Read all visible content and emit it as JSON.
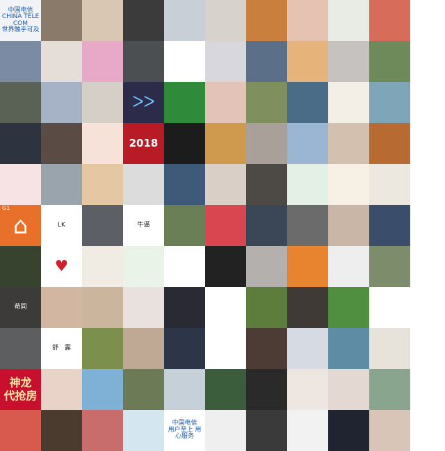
{
  "tiles": [
    {
      "bg": "#f1f3f7",
      "fg": "#1e5aa8",
      "caption": "中国电信\nCHINA TELECOM\n世界触手可及",
      "icon": "",
      "style": "",
      "name": "tile-china-telecom-logo"
    },
    {
      "bg": "#8a7a6a",
      "fg": "",
      "caption": "",
      "icon": "",
      "style": "",
      "name": "tile-photo-portrait"
    },
    {
      "bg": "#d9c6b3",
      "fg": "",
      "caption": "",
      "icon": "",
      "style": "",
      "name": "tile-photo-children"
    },
    {
      "bg": "#3b3b3b",
      "fg": "",
      "caption": "",
      "icon": "",
      "style": "",
      "name": "tile-photo-couple"
    },
    {
      "bg": "#c9cfd6",
      "fg": "",
      "caption": "",
      "icon": "",
      "style": "",
      "name": "tile-photo-beach"
    },
    {
      "bg": "#d8d2cc",
      "fg": "",
      "caption": "",
      "icon": "",
      "style": "",
      "name": "tile-photo-woman"
    },
    {
      "bg": "#c97f3d",
      "fg": "",
      "caption": "",
      "icon": "",
      "style": "",
      "name": "tile-photo-cat"
    },
    {
      "bg": "#e6c2b3",
      "fg": "",
      "caption": "",
      "icon": "",
      "style": "",
      "name": "tile-photo-selfie"
    },
    {
      "bg": "#e9ece5",
      "fg": "",
      "caption": "",
      "icon": "",
      "style": "",
      "name": "tile-photo-cartoon"
    },
    {
      "bg": "#d86c5a",
      "fg": "",
      "caption": "",
      "icon": "",
      "style": "",
      "name": "tile-photo-toy"
    },
    {
      "bg": "#7a8ba3",
      "fg": "",
      "caption": "",
      "icon": "",
      "style": "",
      "name": "tile-photo-costume"
    },
    {
      "bg": "#e5ddd7",
      "fg": "",
      "caption": "",
      "icon": "",
      "style": "",
      "name": "tile-photo-portrait"
    },
    {
      "bg": "#e7a9c7",
      "fg": "",
      "caption": "",
      "icon": "",
      "style": "",
      "name": "tile-photo-pink-pig"
    },
    {
      "bg": "#4b4f52",
      "fg": "",
      "caption": "",
      "icon": "",
      "style": "",
      "name": "tile-photo-room"
    },
    {
      "bg": "#ffffff",
      "fg": "",
      "caption": "",
      "icon": "",
      "style": "",
      "name": "tile-blank"
    },
    {
      "bg": "#d7d7dd",
      "fg": "",
      "caption": "",
      "icon": "",
      "style": "",
      "name": "tile-photo-umbrella"
    },
    {
      "bg": "#5c6f88",
      "fg": "",
      "caption": "",
      "icon": "",
      "style": "",
      "name": "tile-photo-road"
    },
    {
      "bg": "#e6b47a",
      "fg": "",
      "caption": "",
      "icon": "",
      "style": "",
      "name": "tile-photo-doll"
    },
    {
      "bg": "#c5c2bf",
      "fg": "",
      "caption": "",
      "icon": "",
      "style": "",
      "name": "tile-photo-wedding"
    },
    {
      "bg": "#6e8a5a",
      "fg": "",
      "caption": "",
      "icon": "",
      "style": "",
      "name": "tile-photo-rain"
    },
    {
      "bg": "#5a6256",
      "fg": "",
      "caption": "",
      "icon": "",
      "style": "",
      "name": "tile-photo-window"
    },
    {
      "bg": "#a6b3c6",
      "fg": "",
      "caption": "",
      "icon": "",
      "style": "",
      "name": "tile-photo-kimono"
    },
    {
      "bg": "#d6cfc8",
      "fg": "",
      "caption": "",
      "icon": "",
      "style": "",
      "name": "tile-photo-flowers"
    },
    {
      "bg": "#2c2c4a",
      "fg": "#6ec6ff",
      "caption": "",
      "icon": "ᐳᐳ",
      "style": "",
      "name": "tile-logo-zigzag"
    },
    {
      "bg": "#2f8a3a",
      "fg": "",
      "caption": "",
      "icon": "",
      "style": "",
      "name": "tile-photo-panda"
    },
    {
      "bg": "#e3c3b8",
      "fg": "",
      "caption": "",
      "icon": "",
      "style": "",
      "name": "tile-photo-hand-toy"
    },
    {
      "bg": "#7f8f5e",
      "fg": "",
      "caption": "",
      "icon": "",
      "style": "",
      "name": "tile-photo-bunny-ears"
    },
    {
      "bg": "#4a6c86",
      "fg": "",
      "caption": "",
      "icon": "",
      "style": "",
      "name": "tile-photo-mountains"
    },
    {
      "bg": "#f4efe6",
      "fg": "",
      "caption": "",
      "icon": "",
      "style": "",
      "name": "tile-photo-anime-girl"
    },
    {
      "bg": "#7fa6b8",
      "fg": "",
      "caption": "",
      "icon": "",
      "style": "",
      "name": "tile-photo-sea"
    },
    {
      "bg": "#2d3440",
      "fg": "",
      "caption": "",
      "icon": "",
      "style": "",
      "name": "tile-photo-man-desk"
    },
    {
      "bg": "#5a4c45",
      "fg": "",
      "caption": "",
      "icon": "",
      "style": "",
      "name": "tile-photo-woman-art"
    },
    {
      "bg": "#f6e2d8",
      "fg": "",
      "caption": "",
      "icon": "",
      "style": "",
      "name": "tile-photo-pink-sketch"
    },
    {
      "bg": "#b81b26",
      "fg": "#ffffff",
      "caption": "2018",
      "icon": "",
      "style": "big",
      "name": "tile-2018-banner"
    },
    {
      "bg": "#1c1c1c",
      "fg": "",
      "caption": "",
      "icon": "",
      "style": "",
      "name": "tile-photo-black-cat"
    },
    {
      "bg": "#cf9a4d",
      "fg": "",
      "caption": "",
      "icon": "",
      "style": "",
      "name": "tile-photo-pastry"
    },
    {
      "bg": "#a9a09a",
      "fg": "",
      "caption": "",
      "icon": "",
      "style": "",
      "name": "tile-photo-figures"
    },
    {
      "bg": "#9bb6d2",
      "fg": "",
      "caption": "",
      "icon": "",
      "style": "",
      "name": "tile-photo-field"
    },
    {
      "bg": "#d4c0ae",
      "fg": "",
      "caption": "",
      "icon": "",
      "style": "",
      "name": "tile-photo-hair"
    },
    {
      "bg": "#b86a33",
      "fg": "",
      "caption": "",
      "icon": "",
      "style": "",
      "name": "tile-photo-monkey-king"
    },
    {
      "bg": "#f7e3e3",
      "fg": "",
      "caption": "",
      "icon": "",
      "style": "",
      "name": "tile-photo-pig-frame"
    },
    {
      "bg": "#9aa4ad",
      "fg": "",
      "caption": "",
      "icon": "",
      "style": "",
      "name": "tile-photo-clouds"
    },
    {
      "bg": "#e6c7a3",
      "fg": "",
      "caption": "",
      "icon": "",
      "style": "",
      "name": "tile-photo-kitten"
    },
    {
      "bg": "#dcdcdc",
      "fg": "",
      "caption": "",
      "icon": "",
      "style": "",
      "name": "tile-photo-man-window"
    },
    {
      "bg": "#3e5a78",
      "fg": "",
      "caption": "",
      "icon": "",
      "style": "",
      "name": "tile-photo-man-blue"
    },
    {
      "bg": "#d9cfc7",
      "fg": "",
      "caption": "",
      "icon": "",
      "style": "",
      "name": "tile-photo-doll-girl"
    },
    {
      "bg": "#4d4a45",
      "fg": "",
      "caption": "",
      "icon": "",
      "style": "",
      "name": "tile-photo-dog"
    },
    {
      "bg": "#e4efe6",
      "fg": "#2f7a52",
      "caption": "",
      "icon": "",
      "style": "",
      "name": "tile-logo-green-cube"
    },
    {
      "bg": "#f6f1e4",
      "fg": "",
      "caption": "",
      "icon": "",
      "style": "",
      "name": "tile-photo-illustration"
    },
    {
      "bg": "#ece7df",
      "fg": "",
      "caption": "",
      "icon": "",
      "style": "",
      "name": "tile-photo-braid"
    },
    {
      "bg": "#e8702a",
      "fg": "#ffffff",
      "caption": "G1",
      "icon": "⌂",
      "style": "house",
      "name": "tile-house-logo"
    },
    {
      "bg": "#ffffff",
      "fg": "#222222",
      "caption": "LK",
      "icon": "",
      "style": "",
      "name": "tile-lk-text"
    },
    {
      "bg": "#5c5f66",
      "fg": "",
      "caption": "",
      "icon": "",
      "style": "",
      "name": "tile-photo-man-suit"
    },
    {
      "bg": "#ffffff",
      "fg": "#111111",
      "caption": "牛逼",
      "icon": "",
      "style": "",
      "name": "tile-cartoon-sunglasses"
    },
    {
      "bg": "#6a7f56",
      "fg": "",
      "caption": "",
      "icon": "",
      "style": "",
      "name": "tile-photo-tea"
    },
    {
      "bg": "#d9464f",
      "fg": "",
      "caption": "",
      "icon": "",
      "style": "",
      "name": "tile-photo-drink"
    },
    {
      "bg": "#3b4756",
      "fg": "",
      "caption": "",
      "icon": "",
      "style": "",
      "name": "tile-photo-man-tie"
    },
    {
      "bg": "#6b6b6b",
      "fg": "",
      "caption": "",
      "icon": "",
      "style": "",
      "name": "tile-photo-long-hair"
    },
    {
      "bg": "#c9b6a6",
      "fg": "",
      "caption": "",
      "icon": "",
      "style": "",
      "name": "tile-photo-girl"
    },
    {
      "bg": "#3a4d6b",
      "fg": "",
      "caption": "",
      "icon": "",
      "style": "",
      "name": "tile-photo-boy"
    },
    {
      "bg": "#37422f",
      "fg": "",
      "caption": "",
      "icon": "",
      "style": "",
      "name": "tile-photo-woman-tree"
    },
    {
      "bg": "#ffffff",
      "fg": "#d0202a",
      "caption": "",
      "icon": "♥",
      "style": "",
      "name": "tile-heart"
    },
    {
      "bg": "#f0ece4",
      "fg": "",
      "caption": "",
      "icon": "",
      "style": "",
      "name": "tile-photo-glasses"
    },
    {
      "bg": "#eaf3e8",
      "fg": "",
      "caption": "",
      "icon": "",
      "style": "",
      "name": "tile-photo-fruit"
    },
    {
      "bg": "#ffffff",
      "fg": "#333333",
      "caption": "",
      "icon": "",
      "style": "",
      "name": "tile-handwriting"
    },
    {
      "bg": "#222222",
      "fg": "",
      "caption": "",
      "icon": "",
      "style": "",
      "name": "tile-photo-man-dark"
    },
    {
      "bg": "#b4b0ae",
      "fg": "",
      "caption": "",
      "icon": "",
      "style": "",
      "name": "tile-photo-woman-smile"
    },
    {
      "bg": "#e88430",
      "fg": "",
      "caption": "",
      "icon": "",
      "style": "",
      "name": "tile-photo-cat-hat"
    },
    {
      "bg": "#eeeeee",
      "fg": "",
      "caption": "",
      "icon": "",
      "style": "",
      "name": "tile-photo-bw-man"
    },
    {
      "bg": "#7d8c6b",
      "fg": "",
      "caption": "",
      "icon": "",
      "style": "",
      "name": "tile-photo-man-hat"
    },
    {
      "bg": "#3d3a3a",
      "fg": "#ffffff",
      "caption": "苟同",
      "icon": "",
      "style": "",
      "name": "tile-hand-text"
    },
    {
      "bg": "#d2b6a1",
      "fg": "",
      "caption": "",
      "icon": "",
      "style": "",
      "name": "tile-photo-child"
    },
    {
      "bg": "#cbb59d",
      "fg": "",
      "caption": "",
      "icon": "",
      "style": "",
      "name": "tile-photo-cat-face"
    },
    {
      "bg": "#e9e1dd",
      "fg": "",
      "caption": "",
      "icon": "",
      "style": "",
      "name": "tile-photo-girl-sofa"
    },
    {
      "bg": "#2a2a35",
      "fg": "",
      "caption": "",
      "icon": "",
      "style": "",
      "name": "tile-photo-red-jacket"
    },
    {
      "bg": "#ffffff",
      "fg": "#111111",
      "caption": "",
      "icon": "",
      "style": "",
      "name": "tile-stick-figure"
    },
    {
      "bg": "#5d7d3d",
      "fg": "",
      "caption": "",
      "icon": "",
      "style": "",
      "name": "tile-photo-shiba"
    },
    {
      "bg": "#3f3a35",
      "fg": "",
      "caption": "",
      "icon": "",
      "style": "",
      "name": "tile-photo-man-sitting"
    },
    {
      "bg": "#4f8f3f",
      "fg": "",
      "caption": "",
      "icon": "",
      "style": "",
      "name": "tile-cartoon-mario"
    },
    {
      "bg": "#ffffff",
      "fg": "#e84a3a",
      "caption": "",
      "icon": "",
      "style": "",
      "name": "tile-cartoon-penguin"
    },
    {
      "bg": "#5c5e60",
      "fg": "",
      "caption": "",
      "icon": "",
      "style": "",
      "name": "tile-photo-bird"
    },
    {
      "bg": "#ffffff",
      "fg": "#222222",
      "caption": "舒　露",
      "icon": "",
      "style": "",
      "name": "tile-calligraphy"
    },
    {
      "bg": "#7c8f4d",
      "fg": "",
      "caption": "",
      "icon": "",
      "style": "",
      "name": "tile-photo-tree"
    },
    {
      "bg": "#bfa894",
      "fg": "",
      "caption": "",
      "icon": "",
      "style": "",
      "name": "tile-photo-woman-face"
    },
    {
      "bg": "#2c3648",
      "fg": "",
      "caption": "",
      "icon": "",
      "style": "",
      "name": "tile-photo-bear"
    },
    {
      "bg": "#ffffff",
      "fg": "",
      "caption": "",
      "icon": "",
      "style": "",
      "name": "tile-photo-dogs"
    },
    {
      "bg": "#4d3b35",
      "fg": "",
      "caption": "",
      "icon": "",
      "style": "",
      "name": "tile-photo-man-coat"
    },
    {
      "bg": "#d6dbe3",
      "fg": "",
      "caption": "",
      "icon": "",
      "style": "",
      "name": "tile-photo-car"
    },
    {
      "bg": "#5f8ca5",
      "fg": "",
      "caption": "",
      "icon": "",
      "style": "",
      "name": "tile-photo-lake"
    },
    {
      "bg": "#e7e2da",
      "fg": "",
      "caption": "",
      "icon": "",
      "style": "",
      "name": "tile-photo-man-glasses"
    },
    {
      "bg": "#c8102e",
      "fg": "#ffe9a8",
      "caption": "神龙\n代抢房",
      "icon": "",
      "style": "ml",
      "name": "tile-red-banner"
    },
    {
      "bg": "#e9d3c8",
      "fg": "",
      "caption": "",
      "icon": "",
      "style": "",
      "name": "tile-photo-kid-bow"
    },
    {
      "bg": "#7fb0d6",
      "fg": "",
      "caption": "",
      "icon": "",
      "style": "",
      "name": "tile-photo-red-dress"
    },
    {
      "bg": "#6c7a56",
      "fg": "",
      "caption": "",
      "icon": "",
      "style": "",
      "name": "tile-photo-family"
    },
    {
      "bg": "#c5d0d8",
      "fg": "",
      "caption": "",
      "icon": "",
      "style": "",
      "name": "tile-photo-pier"
    },
    {
      "bg": "#3b5d3b",
      "fg": "",
      "caption": "",
      "icon": "",
      "style": "",
      "name": "tile-photo-crowd"
    },
    {
      "bg": "#2a2a2a",
      "fg": "",
      "caption": "",
      "icon": "",
      "style": "",
      "name": "tile-photo-dark-man"
    },
    {
      "bg": "#ede6e1",
      "fg": "",
      "caption": "",
      "icon": "",
      "style": "",
      "name": "tile-photo-girl-bangs"
    },
    {
      "bg": "#e3d8d2",
      "fg": "",
      "caption": "",
      "icon": "",
      "style": "",
      "name": "tile-photo-woman-pink"
    },
    {
      "bg": "#8aa58d",
      "fg": "",
      "caption": "",
      "icon": "",
      "style": "",
      "name": "tile-photo-statue"
    },
    {
      "bg": "#d85a4e",
      "fg": "",
      "caption": "",
      "icon": "",
      "style": "",
      "name": "tile-photo-boy-red"
    },
    {
      "bg": "#4b3a2e",
      "fg": "",
      "caption": "",
      "icon": "",
      "style": "",
      "name": "tile-photo-cartoon-bald"
    },
    {
      "bg": "#c96c6c",
      "fg": "",
      "caption": "",
      "icon": "",
      "style": "",
      "name": "tile-photo-sunglasses-girl"
    },
    {
      "bg": "#d4e6ef",
      "fg": "",
      "caption": "",
      "icon": "",
      "style": "",
      "name": "tile-photo-snowman"
    },
    {
      "bg": "#ffffff",
      "fg": "#1e5aa8",
      "caption": "中国电信\n用户至上 用心服务",
      "icon": "",
      "style": "",
      "name": "tile-china-telecom-service"
    },
    {
      "bg": "#efefef",
      "fg": "",
      "caption": "",
      "icon": "",
      "style": "",
      "name": "tile-photo-woman-coat"
    },
    {
      "bg": "#3a3a3a",
      "fg": "",
      "caption": "",
      "icon": "",
      "style": "",
      "name": "tile-photo-man-closeup"
    },
    {
      "bg": "#f2f2f2",
      "fg": "",
      "caption": "",
      "icon": "",
      "style": "",
      "name": "tile-photo-clothes"
    },
    {
      "bg": "#1f2430",
      "fg": "",
      "caption": "",
      "icon": "",
      "style": "",
      "name": "tile-photo-night"
    },
    {
      "bg": "#d9c4b8",
      "fg": "",
      "caption": "",
      "icon": "",
      "style": "",
      "name": "tile-photo-couple-selfie"
    }
  ]
}
